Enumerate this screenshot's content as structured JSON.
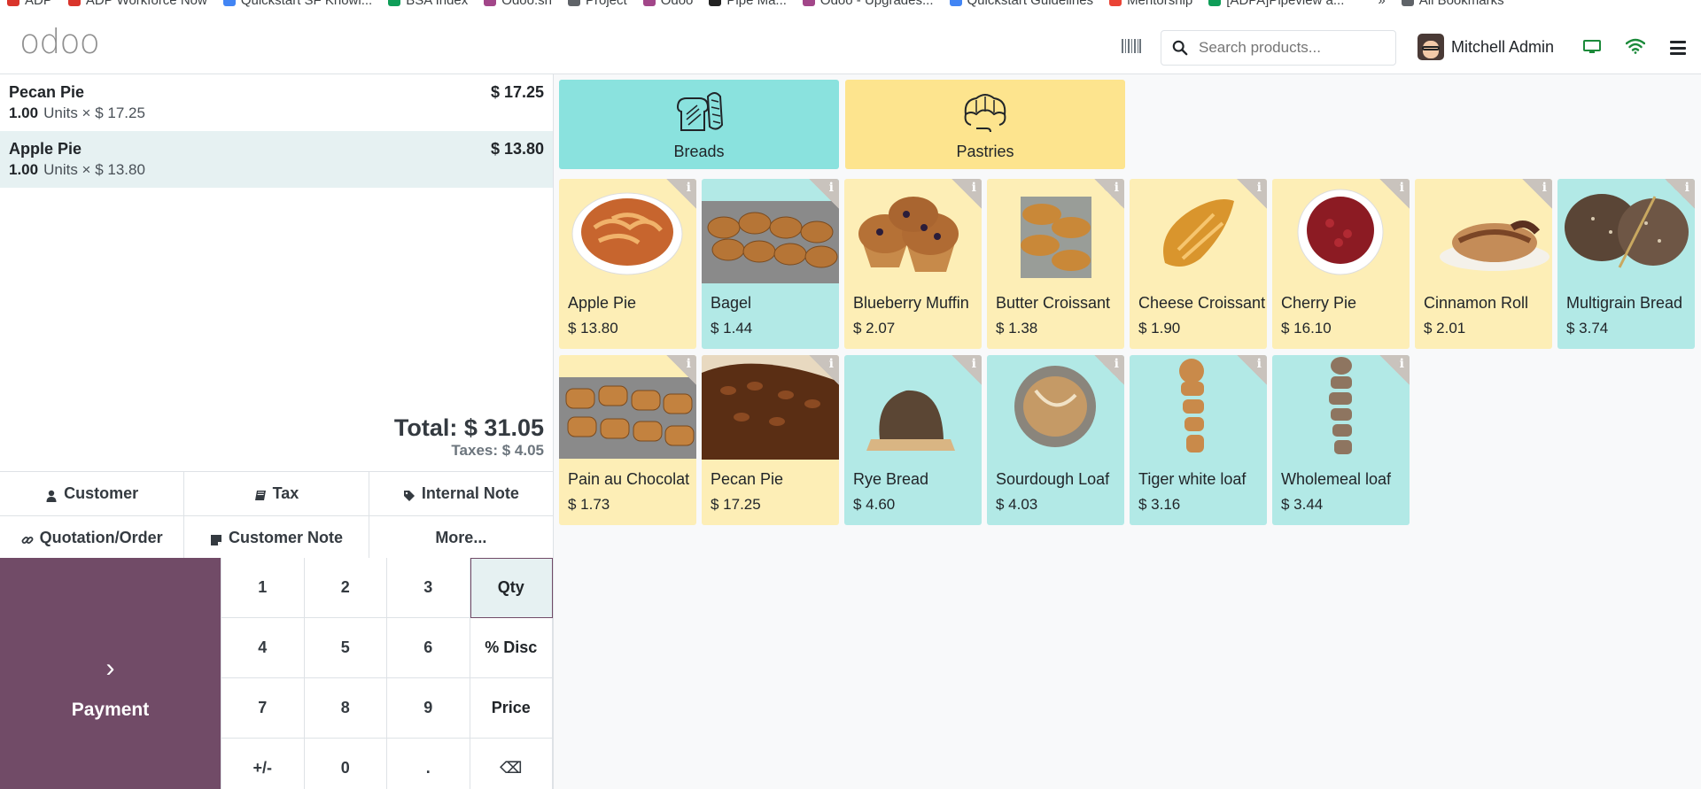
{
  "bookmarks": [
    {
      "label": "ADP",
      "color": "#d9342b"
    },
    {
      "label": "ADP Workforce Now",
      "color": "#d9342b"
    },
    {
      "label": "Quickstart SF Knowl...",
      "color": "#4285f4"
    },
    {
      "label": "BSA Index",
      "color": "#0f9d58"
    },
    {
      "label": "Odoo.sh",
      "color": "#a24689"
    },
    {
      "label": "Project",
      "color": "#5f6368"
    },
    {
      "label": "Odoo",
      "color": "#a24689"
    },
    {
      "label": "Pipe Ma...",
      "color": "#222222"
    },
    {
      "label": "Odoo - Upgrades...",
      "color": "#a24689"
    },
    {
      "label": "Quickstart Guidelines",
      "color": "#4285f4"
    },
    {
      "label": "Mentorship",
      "color": "#ea4335"
    },
    {
      "label": "[ADPA]Pipeview a...",
      "color": "#0f9d58"
    },
    {
      "label": "»",
      "color": "#ffffff"
    },
    {
      "label": "All Bookmarks",
      "color": "#5f6368"
    }
  ],
  "header": {
    "logo": "odoo",
    "search_placeholder": "Search products...",
    "user_name": "Mitchell Admin",
    "accent": "#714b67"
  },
  "order": {
    "lines": [
      {
        "name": "Pecan Pie",
        "price": "$ 17.25",
        "qty": "1.00",
        "detail": "Units × $ 17.25",
        "selected": false
      },
      {
        "name": "Apple Pie",
        "price": "$ 13.80",
        "qty": "1.00",
        "detail": "Units × $ 13.80",
        "selected": true
      }
    ],
    "total": "Total: $ 31.05",
    "taxes": "Taxes: $ 4.05"
  },
  "actions": {
    "row1": [
      {
        "label": "Customer",
        "icon": "user-icon"
      },
      {
        "label": "Tax",
        "icon": "book-icon"
      },
      {
        "label": "Internal Note",
        "icon": "tag-icon"
      }
    ],
    "row2": [
      {
        "label": "Quotation/Order",
        "icon": "link-icon"
      },
      {
        "label": "Customer Note",
        "icon": "sticky-note-icon"
      },
      {
        "label": "More...",
        "icon": ""
      }
    ]
  },
  "numpad": {
    "payment_label": "Payment",
    "keys": [
      "1",
      "2",
      "3",
      "Qty",
      "4",
      "5",
      "6",
      "% Disc",
      "7",
      "8",
      "9",
      "Price",
      "+/-",
      "0",
      ".",
      "⌫"
    ],
    "active": "Qty"
  },
  "categories": [
    {
      "label": "Breads",
      "color": "#8ae2de",
      "icon": "bread-icon"
    },
    {
      "label": "Pastries",
      "color": "#fde48e",
      "icon": "croissant-icon"
    }
  ],
  "products": [
    {
      "name": "Apple Pie",
      "price": "$ 13.80",
      "tone": "yellow",
      "image": "apple-pie-image"
    },
    {
      "name": "Bagel",
      "price": "$ 1.44",
      "tone": "teal",
      "image": "bagel-image"
    },
    {
      "name": "Blueberry Muffin",
      "price": "$ 2.07",
      "tone": "yellow",
      "image": "blueberry-muffin-image"
    },
    {
      "name": "Butter Croissant",
      "price": "$ 1.38",
      "tone": "yellow",
      "image": "butter-croissant-image"
    },
    {
      "name": "Cheese Croissant",
      "price": "$ 1.90",
      "tone": "yellow",
      "image": "cheese-croissant-image"
    },
    {
      "name": "Cherry Pie",
      "price": "$ 16.10",
      "tone": "yellow",
      "image": "cherry-pie-image"
    },
    {
      "name": "Cinnamon Roll",
      "price": "$ 2.01",
      "tone": "yellow",
      "image": "cinnamon-roll-image"
    },
    {
      "name": "Multigrain Bread",
      "price": "$ 3.74",
      "tone": "teal",
      "image": "multigrain-bread-image"
    },
    {
      "name": "Pain au Chocolat",
      "price": "$ 1.73",
      "tone": "yellow",
      "image": "pain-au-chocolat-image"
    },
    {
      "name": "Pecan Pie",
      "price": "$ 17.25",
      "tone": "yellow",
      "image": "pecan-pie-image"
    },
    {
      "name": "Rye Bread",
      "price": "$ 4.60",
      "tone": "teal",
      "image": "rye-bread-image"
    },
    {
      "name": "Sourdough Loaf",
      "price": "$ 4.03",
      "tone": "teal",
      "image": "sourdough-loaf-image"
    },
    {
      "name": "Tiger white loaf",
      "price": "$ 3.16",
      "tone": "teal",
      "image": "tiger-white-loaf-image"
    },
    {
      "name": "Wholemeal loaf",
      "price": "$ 3.44",
      "tone": "teal",
      "image": "wholemeal-loaf-image"
    }
  ]
}
